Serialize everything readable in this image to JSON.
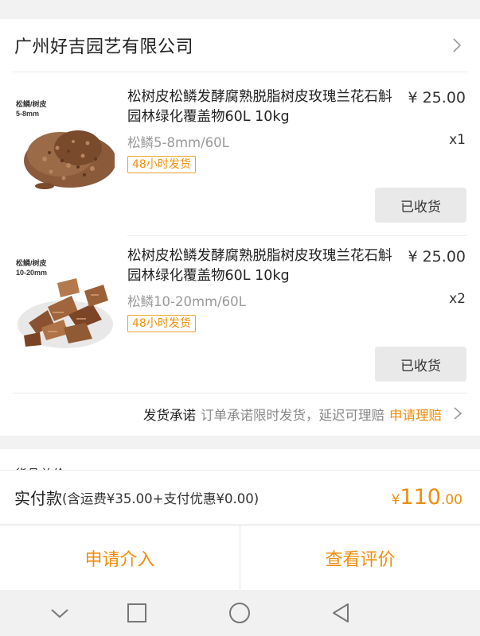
{
  "shop": {
    "name": "广州好吉园艺有限公司"
  },
  "items": [
    {
      "thumb_label_1": "松鳞/树皮",
      "thumb_label_2": "5-8mm",
      "title": "松树皮松鳞发酵腐熟脱脂树皮玫瑰兰花石斛园林绿化覆盖物60L 10kg",
      "price": "¥ 25.00",
      "spec": "松鳞5-8mm/60L",
      "qty": "x1",
      "badge": "48小时发货",
      "button": "已收货"
    },
    {
      "thumb_label_1": "松鳞/树皮",
      "thumb_label_2": "10-20mm",
      "title": "松树皮松鳞发酵腐熟脱脂树皮玫瑰兰花石斛园林绿化覆盖物60L 10kg",
      "price": "¥ 25.00",
      "spec": "松鳞10-20mm/60L",
      "qty": "x2",
      "badge": "48小时发货",
      "button": "已收货"
    }
  ],
  "promise": {
    "label": "发货承诺",
    "desc": "订单承诺限时发货，延迟可理赔",
    "link": "申请理赔"
  },
  "peek": {
    "text": "货品总价"
  },
  "payment": {
    "label": "实付款",
    "detail": "(含运费¥35.00+支付优惠¥0.00)",
    "currency": "¥",
    "amount_int": "110",
    "amount_dec": ".00"
  },
  "actions": {
    "intervene": "申请介入",
    "review": "查看评价"
  },
  "colors": {
    "accent": "#f08c0a",
    "badge_border": "#f0a02a",
    "muted_text": "#9a9a9a",
    "button_bg": "#e9e9e9"
  },
  "icons": {
    "shop_chevron": "chevron-right-icon",
    "promise_chevron": "chevron-right-icon",
    "nav_back_collapse": "chevron-down-icon",
    "nav_recents": "square-icon",
    "nav_home": "circle-icon",
    "nav_back": "triangle-back-icon"
  }
}
